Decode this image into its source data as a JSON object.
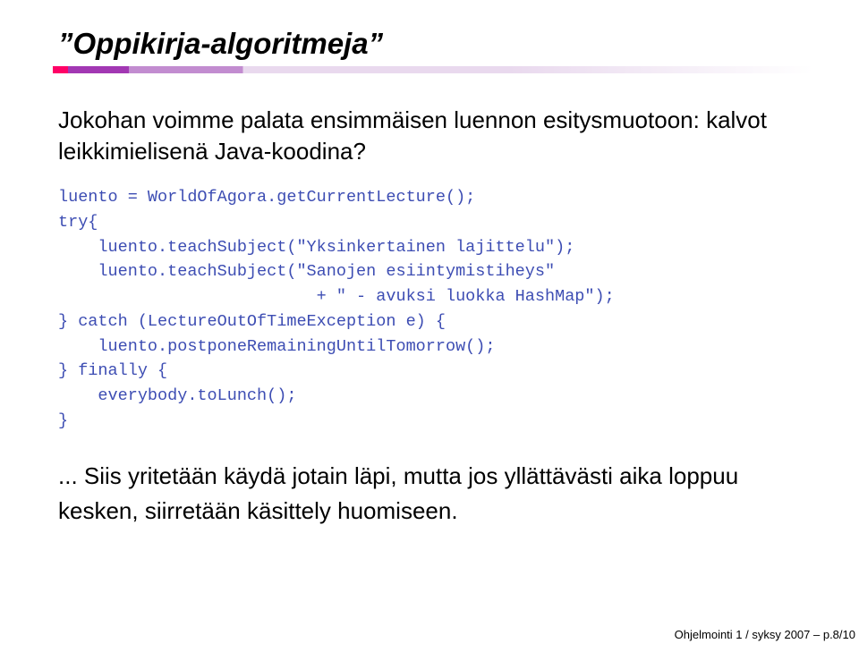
{
  "slide": {
    "title": "”Oppikirja-algoritmeja”",
    "intro": "Jokohan voimme palata ensimmäisen luennon esitysmuotoon: kalvot leikkimielisenä Java-koodina?",
    "code": "luento = WorldOfAgora.getCurrentLecture();\ntry{\n    luento.teachSubject(\"Yksinkertainen lajittelu\");\n    luento.teachSubject(\"Sanojen esiintymistiheys\"\n                          + \" - avuksi luokka HashMap\");\n} catch (LectureOutOfTimeException e) {\n    luento.postponeRemainingUntilTomorrow();\n} finally {\n    everybody.toLunch();\n}",
    "outro": "... Siis yritetään käydä jotain läpi, mutta jos yllättävästi aika loppuu kesken, siirretään käsittely huomiseen.",
    "footer": "Ohjelmointi 1 / syksy 2007 – p.8/10"
  }
}
